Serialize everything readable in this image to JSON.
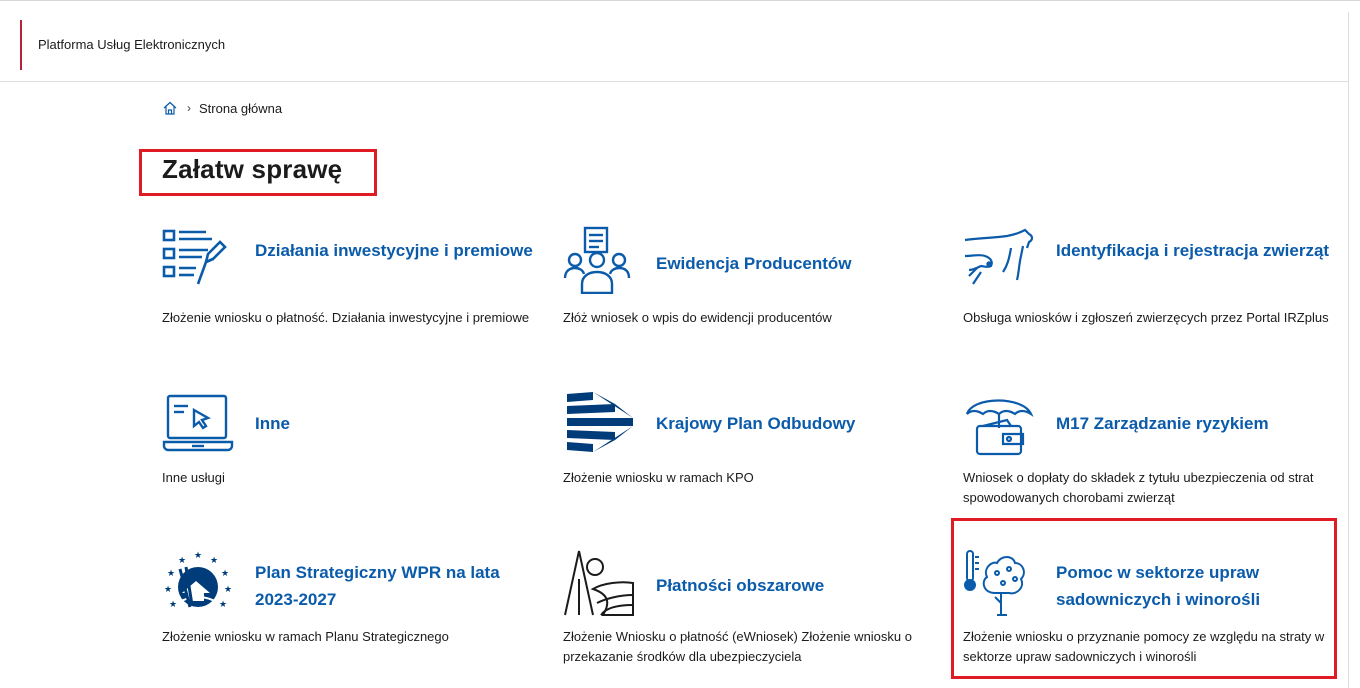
{
  "header": {
    "title": "Platforma Usług Elektronicznych"
  },
  "breadcrumb": {
    "items": [
      "Strona główna"
    ]
  },
  "page": {
    "title": "Załatw sprawę"
  },
  "tiles": [
    {
      "title": "Działania inwestycyjne i premiowe",
      "desc": "Złożenie wniosku o płatność. Działania inwestycyjne i premiowe",
      "icon": "document-list-pen-icon"
    },
    {
      "title": "Ewidencja Producentów",
      "desc": "Złóż wniosek o wpis do ewidencji producentów",
      "icon": "people-document-icon"
    },
    {
      "title": "Identyfikacja i rejestracja zwierząt",
      "desc": "Obsługa wniosków i zgłoszeń zwierzęcych przez Portal IRZplus",
      "icon": "cow-hand-icon"
    },
    {
      "title": "Inne",
      "desc": "Inne usługi",
      "icon": "laptop-cursor-icon"
    },
    {
      "title": "Krajowy Plan Odbudowy",
      "desc": "Złożenie wniosku w ramach KPO",
      "icon": "kpo-logo-icon"
    },
    {
      "title": "M17 Zarządzanie ryzykiem",
      "desc": "Wniosek o dopłaty do składek z tytułu ubezpieczenia od strat spowodowanych chorobami zwierząt",
      "icon": "umbrella-wallet-icon"
    },
    {
      "title": "Plan Strategiczny WPR na lata 2023-2027",
      "desc": "Złożenie wniosku w ramach Planu Strategicznego",
      "icon": "wpr-logo-icon"
    },
    {
      "title": "Płatności obszarowe",
      "desc": "Złożenie Wniosku o płatność (eWniosek) Złożenie wniosku o przekazanie środków dla ubezpieczyciela",
      "icon": "field-tree-icon"
    },
    {
      "title": "Pomoc w sektorze upraw sadowniczych i winorośli",
      "desc": "Złożenie wniosku o przyznanie pomocy ze względu na straty w sektorze upraw sadowniczych i winorośli",
      "icon": "tree-thermometer-icon"
    }
  ],
  "colors": {
    "accent": "#b3233a",
    "link": "#0b5bab",
    "highlight": "#e01b24"
  }
}
